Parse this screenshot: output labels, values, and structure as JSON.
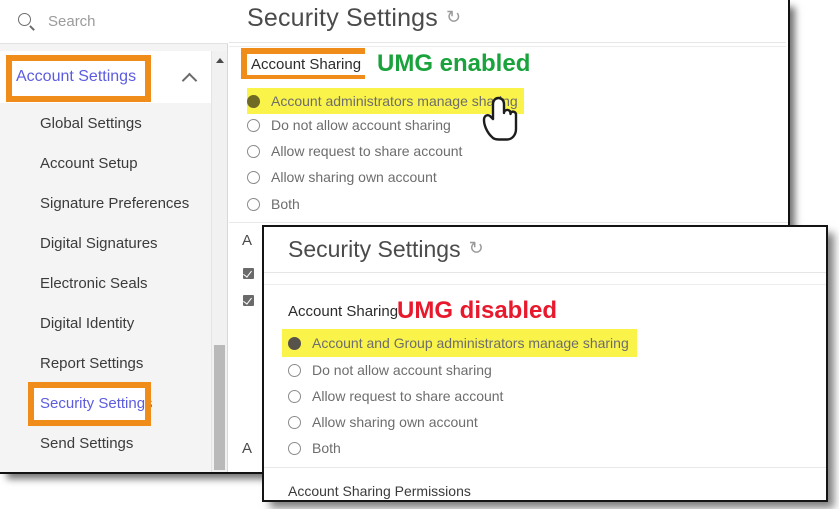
{
  "sidebar": {
    "search": {
      "placeholder": "Search",
      "icon": "search-icon"
    },
    "group_header": {
      "label": "Account Settings",
      "chevron": "chevron-up-icon",
      "highlighted": true
    },
    "items": [
      {
        "label": "Global Settings",
        "selected": false
      },
      {
        "label": "Account Setup",
        "selected": false
      },
      {
        "label": "Signature Preferences",
        "selected": false
      },
      {
        "label": "Digital Signatures",
        "selected": false
      },
      {
        "label": "Electronic Seals",
        "selected": false
      },
      {
        "label": "Digital Identity",
        "selected": false
      },
      {
        "label": "Report Settings",
        "selected": false
      },
      {
        "label": "Security Settings",
        "selected": true
      },
      {
        "label": "Send Settings",
        "selected": false
      }
    ],
    "scrollbar": {
      "up_arrow": "triangle-up-icon"
    }
  },
  "back_panel": {
    "title": "Security Settings",
    "refresh_icon": "refresh-icon",
    "section_label": "Account Sharing",
    "annotation": "UMG enabled",
    "annotation_color": "#1aa33c",
    "options": [
      {
        "label": "Account administrators manage sharing",
        "selected": true,
        "highlighted": true
      },
      {
        "label": "Do not allow account sharing",
        "selected": false,
        "highlighted": false
      },
      {
        "label": "Allow request to share account",
        "selected": false,
        "highlighted": false
      },
      {
        "label": "Allow sharing own account",
        "selected": false,
        "highlighted": false
      },
      {
        "label": "Both",
        "selected": false,
        "highlighted": false
      }
    ],
    "occluded_labels": [
      "A",
      "A"
    ],
    "cursor": "hand-pointer-cursor"
  },
  "front_panel": {
    "title": "Security Settings",
    "refresh_icon": "refresh-icon",
    "section_label": "Account Sharing",
    "annotation": "UMG disabled",
    "annotation_color": "#e8192c",
    "options": [
      {
        "label": "Account and Group administrators manage sharing",
        "selected": true,
        "highlighted": true
      },
      {
        "label": "Do not allow account sharing",
        "selected": false,
        "highlighted": false
      },
      {
        "label": "Allow request to share account",
        "selected": false,
        "highlighted": false
      },
      {
        "label": "Allow sharing own account",
        "selected": false,
        "highlighted": false
      },
      {
        "label": "Both",
        "selected": false,
        "highlighted": false
      }
    ],
    "footer_label": "Account Sharing Permissions"
  },
  "colors": {
    "highlight_box": "#f08c1a",
    "text_highlight": "#faf34a",
    "link": "#5c5ce0"
  }
}
